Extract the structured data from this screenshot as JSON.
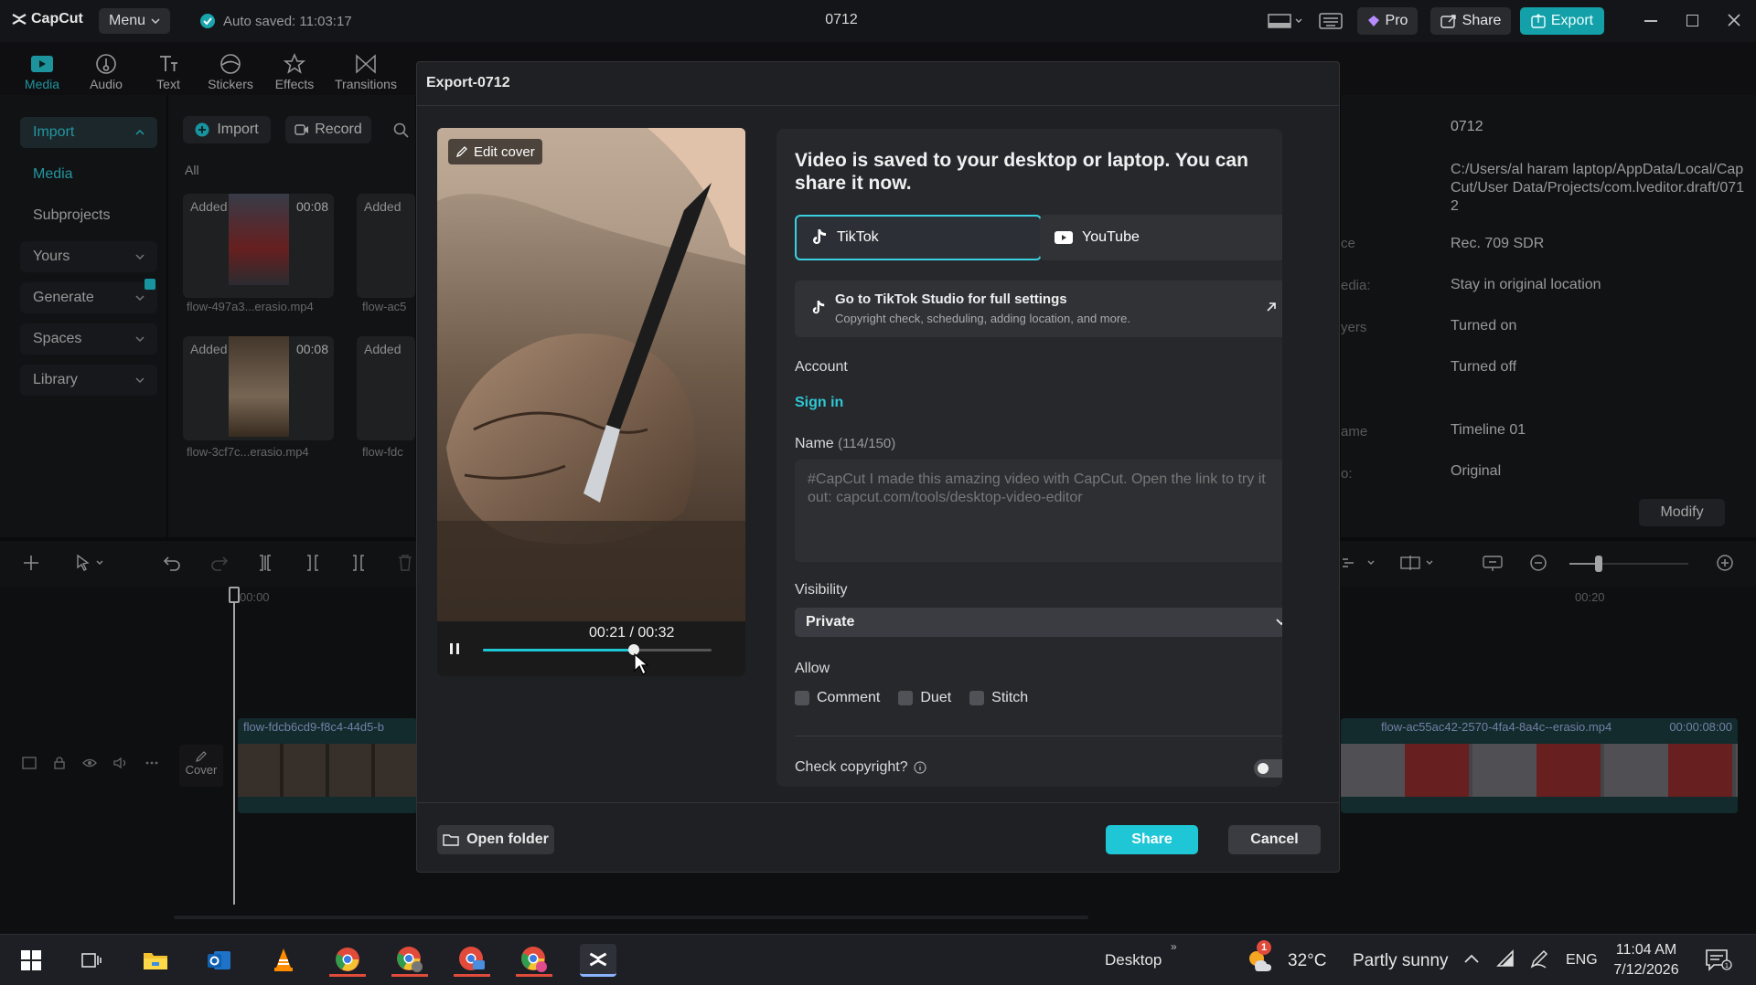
{
  "app": {
    "logo": "CapCut",
    "menu_label": "Menu",
    "autosave": "Auto saved: 11:03:17",
    "project_title": "0712",
    "pro_label": "Pro",
    "share_label": "Share",
    "export_label": "Export"
  },
  "toolbar": [
    {
      "label": "Media",
      "icon": "media-icon"
    },
    {
      "label": "Audio",
      "icon": "audio-icon"
    },
    {
      "label": "Text",
      "icon": "text-icon"
    },
    {
      "label": "Stickers",
      "icon": "sticker-icon"
    },
    {
      "label": "Effects",
      "icon": "effects-icon"
    },
    {
      "label": "Transitions",
      "icon": "transitions-icon"
    }
  ],
  "sidebar": {
    "items": [
      {
        "label": "Import"
      },
      {
        "label": "Media"
      },
      {
        "label": "Subprojects"
      },
      {
        "label": "Yours"
      },
      {
        "label": "Generate"
      },
      {
        "label": "Spaces"
      },
      {
        "label": "Library"
      }
    ]
  },
  "media_panel": {
    "import_label": "Import",
    "record_label": "Record",
    "filter_all": "All",
    "items": [
      {
        "badge": "Added",
        "duration": "00:08",
        "name": "flow-497a3...erasio.mp4"
      },
      {
        "badge": "Added",
        "duration": "",
        "name": "flow-ac5"
      },
      {
        "badge": "Added",
        "duration": "00:08",
        "name": "flow-3cf7c...erasio.mp4"
      },
      {
        "badge": "Added",
        "duration": "",
        "name": "flow-fdc"
      }
    ]
  },
  "properties": {
    "name": "0712",
    "path": "C:/Users/al haram laptop/AppData/Local/CapCut/User Data/Projects/com.lveditor.draft/0712",
    "color_space_label": "ce",
    "color_space": "Rec. 709 SDR",
    "media_label": "edia:",
    "media": "Stay in original location",
    "layers_label": "yers",
    "layers": "Turned on",
    "value4": "Turned off",
    "timeline_label": "ame",
    "timeline": "Timeline 01",
    "ratio_label": "o:",
    "ratio": "Original",
    "modify_label": "Modify"
  },
  "timeline": {
    "time_start": "00:00",
    "time_mid": "00:20",
    "cover_label": "Cover",
    "clip_left": "flow-fdcb6cd9-f8c4-44d5-b",
    "clip_right": "flow-ac55ac42-2570-4fa4-8a4c--erasio.mp4",
    "clip_right_duration": "00:00:08:00"
  },
  "dialog": {
    "title": "Export-0712",
    "edit_cover": "Edit cover",
    "playback_time": "00:21 / 00:32",
    "playback_progress": 0.66,
    "heading": "Video is saved to your desktop or laptop. You can share it now.",
    "platforms": [
      {
        "label": "TikTok",
        "selected": true
      },
      {
        "label": "YouTube",
        "selected": false
      }
    ],
    "studio_title": "Go to TikTok Studio for full settings",
    "studio_sub": "Copyright check, scheduling, adding location, and more.",
    "account_label": "Account",
    "sign_in": "Sign in",
    "name_label": "Name",
    "name_count": "(114/150)",
    "name_value": "#CapCut I made this amazing video with CapCut. Open the link to try it out: capcut.com/tools/desktop-video-editor",
    "visibility_label": "Visibility",
    "visibility_value": "Private",
    "allow_label": "Allow",
    "allow_options": [
      {
        "label": "Comment",
        "checked": false
      },
      {
        "label": "Duet",
        "checked": false
      },
      {
        "label": "Stitch",
        "checked": false
      }
    ],
    "copyright_label": "Check copyright?",
    "copyright_on": false,
    "open_folder": "Open folder",
    "share": "Share",
    "cancel": "Cancel"
  },
  "taskbar": {
    "desktop_label": "Desktop",
    "weather_temp": "32°C",
    "weather_text": "Partly sunny",
    "weather_badge": "1",
    "lang": "ENG",
    "time": "11:04 AM",
    "date": "7/12/2026"
  },
  "colors": {
    "accent": "#1fc6d6",
    "export_btn": "#14a0a8",
    "selected_border": "#3ad0e0"
  }
}
